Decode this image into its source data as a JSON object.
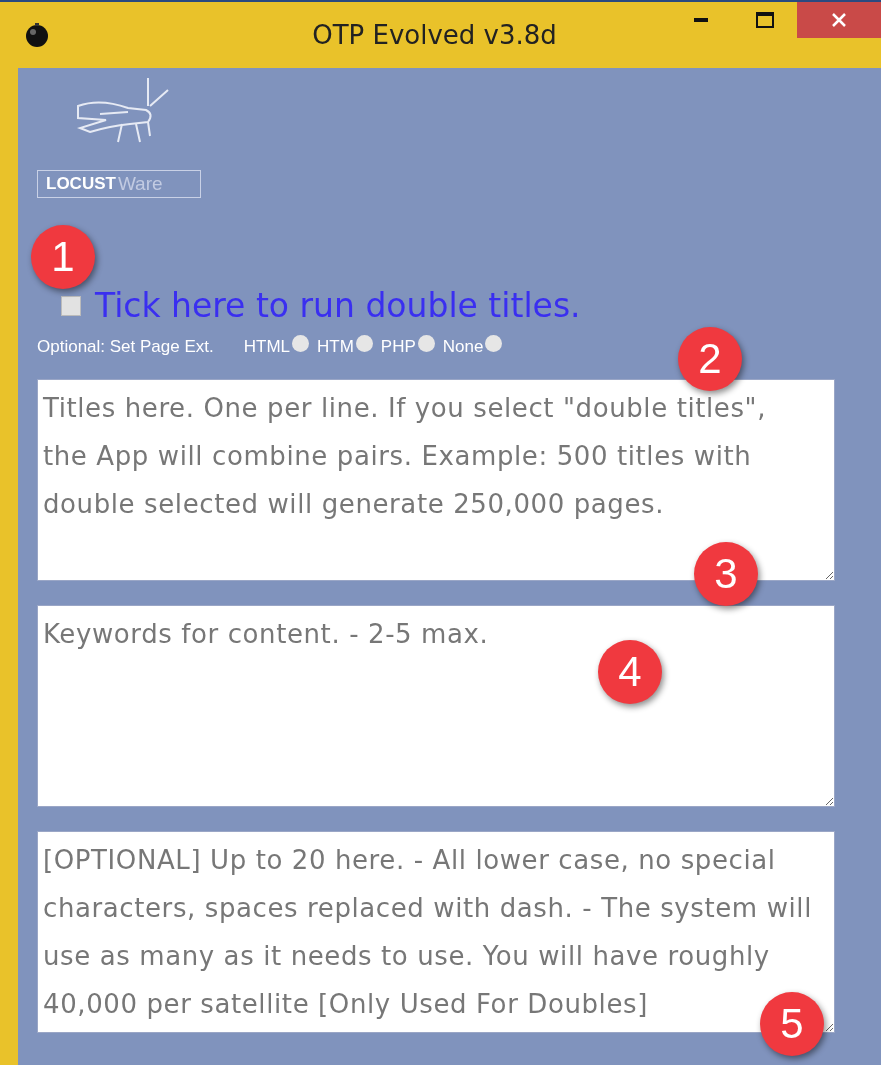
{
  "window": {
    "title": "OTP Evolved v3.8d"
  },
  "logo": {
    "bold": "LOCUST",
    "light": "Ware"
  },
  "double_titles": {
    "label": "Tick here to run double titles.",
    "checked": false
  },
  "page_ext": {
    "label": "Optional: Set Page Ext.",
    "options": [
      {
        "label": "HTML",
        "selected": false
      },
      {
        "label": "HTM",
        "selected": false
      },
      {
        "label": "PHP",
        "selected": false
      },
      {
        "label": "None",
        "selected": false
      }
    ]
  },
  "fields": [
    {
      "placeholder": "Titles here. One per line. If you select \"double titles\", the App will combine pairs. Example: 500 titles with double selected will generate 250,000 pages."
    },
    {
      "placeholder": "Keywords for content. - 2-5 max."
    },
    {
      "placeholder": "[OPTIONAL] Up to 20 here. - All lower case, no special characters, spaces replaced with dash. - The system will use as many as it needs to use. You will have roughly 40,000 per satellite [Only Used For Doubles]"
    }
  ],
  "badges": [
    "1",
    "2",
    "3",
    "4",
    "5"
  ]
}
